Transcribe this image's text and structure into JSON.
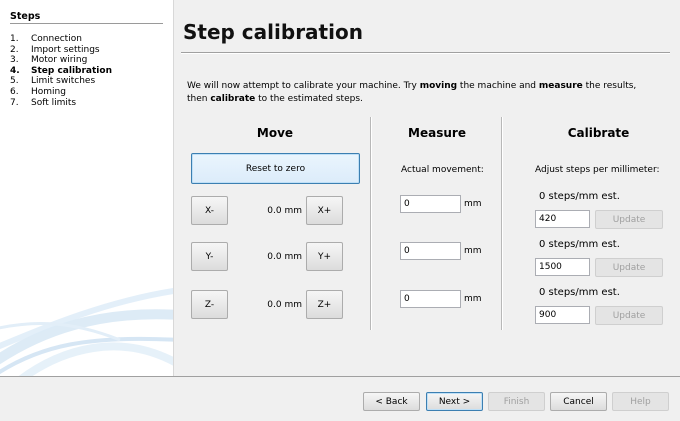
{
  "sidebar": {
    "title": "Steps",
    "items": [
      {
        "num": "1.",
        "label": "Connection",
        "active": false
      },
      {
        "num": "2.",
        "label": "Import settings",
        "active": false
      },
      {
        "num": "3.",
        "label": "Motor wiring",
        "active": false
      },
      {
        "num": "4.",
        "label": "Step calibration",
        "active": true
      },
      {
        "num": "5.",
        "label": "Limit switches",
        "active": false
      },
      {
        "num": "6.",
        "label": "Homing",
        "active": false
      },
      {
        "num": "7.",
        "label": "Soft limits",
        "active": false
      }
    ]
  },
  "page": {
    "title": "Step calibration",
    "intro_1": "We will now attempt to calibrate your machine. Try ",
    "intro_b1": "moving",
    "intro_2": " the machine and ",
    "intro_b2": "measure",
    "intro_3": " the results, then ",
    "intro_b3": "calibrate",
    "intro_4": " to the estimated steps."
  },
  "move": {
    "heading": "Move",
    "reset_label": "Reset to zero",
    "axes": [
      {
        "minus": "X-",
        "plus": "X+",
        "position": "0.0 mm"
      },
      {
        "minus": "Y-",
        "plus": "Y+",
        "position": "0.0 mm"
      },
      {
        "minus": "Z-",
        "plus": "Z+",
        "position": "0.0 mm"
      }
    ]
  },
  "measure": {
    "heading": "Measure",
    "actual_label": "Actual movement:",
    "unit": "mm",
    "values": [
      "0",
      "0",
      "0"
    ]
  },
  "calibrate": {
    "heading": "Calibrate",
    "adjust_label": "Adjust steps per millimeter:",
    "update_label": "Update",
    "rows": [
      {
        "estimate": "0 steps/mm est.",
        "value": "420"
      },
      {
        "estimate": "0 steps/mm est.",
        "value": "1500"
      },
      {
        "estimate": "0 steps/mm est.",
        "value": "900"
      }
    ]
  },
  "footer": {
    "back": "< Back",
    "next": "Next >",
    "finish": "Finish",
    "cancel": "Cancel",
    "help": "Help"
  }
}
